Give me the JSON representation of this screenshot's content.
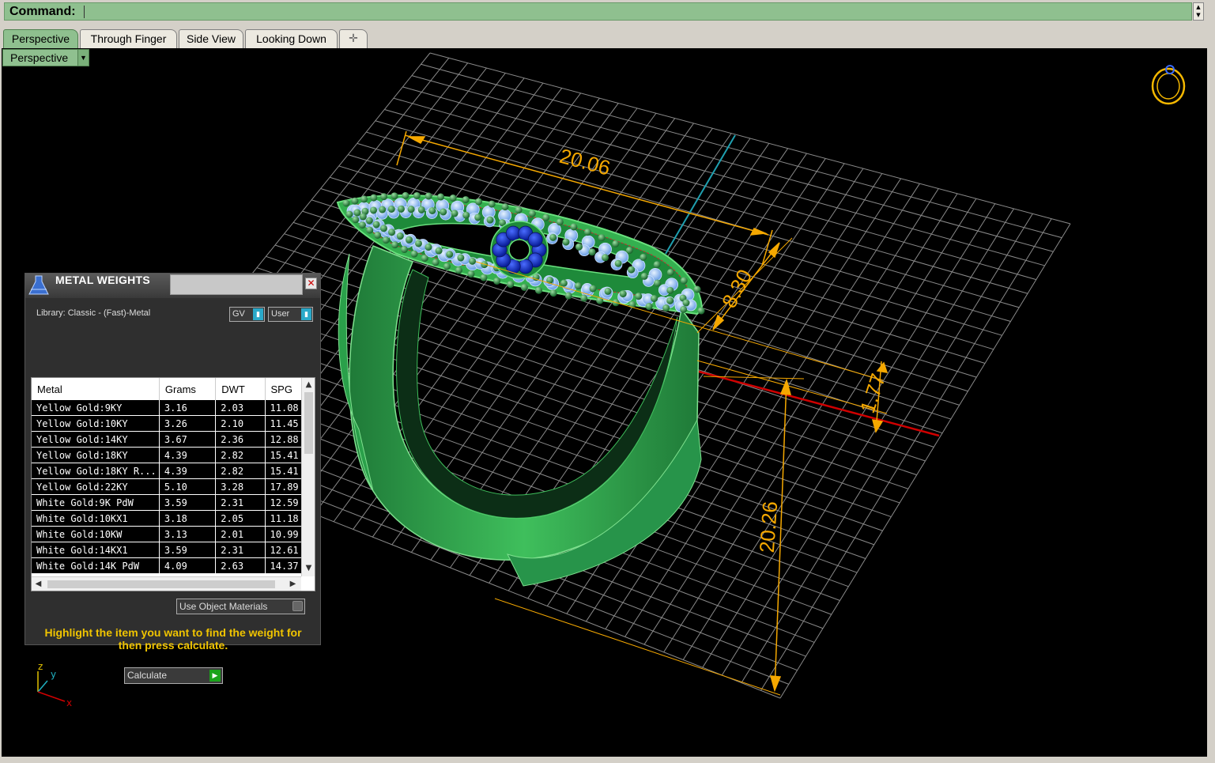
{
  "command": {
    "label": "Command:",
    "value": ""
  },
  "tabs": [
    {
      "label": "Perspective",
      "active": true
    },
    {
      "label": "Through Finger",
      "active": false
    },
    {
      "label": "Side View",
      "active": false
    },
    {
      "label": "Looking Down",
      "active": false
    }
  ],
  "add_tab_icon": "plus-icon",
  "viewport": {
    "label": "Perspective",
    "dimensions": [
      "20.06",
      "8.30",
      "1.77",
      "20.26"
    ],
    "axis_labels": {
      "z": "z",
      "y": "y",
      "x": "x"
    }
  },
  "metal_weights": {
    "title": "METAL WEIGHTS",
    "library": "Library: Classic - (Fast)-Metal",
    "toggle_gv": "GV",
    "toggle_user": "User",
    "columns": [
      "Metal",
      "Grams",
      "DWT",
      "SPG"
    ],
    "rows": [
      [
        "Yellow Gold:9KY",
        "3.16",
        "2.03",
        "11.08"
      ],
      [
        "Yellow Gold:10KY",
        "3.26",
        "2.10",
        "11.45"
      ],
      [
        "Yellow Gold:14KY",
        "3.67",
        "2.36",
        "12.88"
      ],
      [
        "Yellow Gold:18KY",
        "4.39",
        "2.82",
        "15.41"
      ],
      [
        "Yellow Gold:18KY R...",
        "4.39",
        "2.82",
        "15.41"
      ],
      [
        "Yellow Gold:22KY",
        "5.10",
        "3.28",
        "17.89"
      ],
      [
        "White Gold:9K PdW",
        "3.59",
        "2.31",
        "12.59"
      ],
      [
        "White Gold:10KX1",
        "3.18",
        "2.05",
        "11.18"
      ],
      [
        "White Gold:10KW",
        "3.13",
        "2.01",
        "10.99"
      ],
      [
        "White Gold:14KX1",
        "3.59",
        "2.31",
        "12.61"
      ],
      [
        "White Gold:14K PdW",
        "4.09",
        "2.63",
        "14.37"
      ]
    ],
    "use_object_materials": "Use Object Materials",
    "hint": "Highlight the item you want to find the weight for then press calculate.",
    "calculate": "Calculate"
  },
  "colors": {
    "command_bar": "#8fc08f",
    "viewport_bg": "#000000",
    "grid": "#8a8a8a",
    "ring": "#2e9e4a",
    "dimension": "#f5a800",
    "stone_light": "#9ec8ff",
    "stone_dark": "#1a3ccf",
    "x_axis": "#d00000",
    "y_axis": "#1fa0b0"
  }
}
